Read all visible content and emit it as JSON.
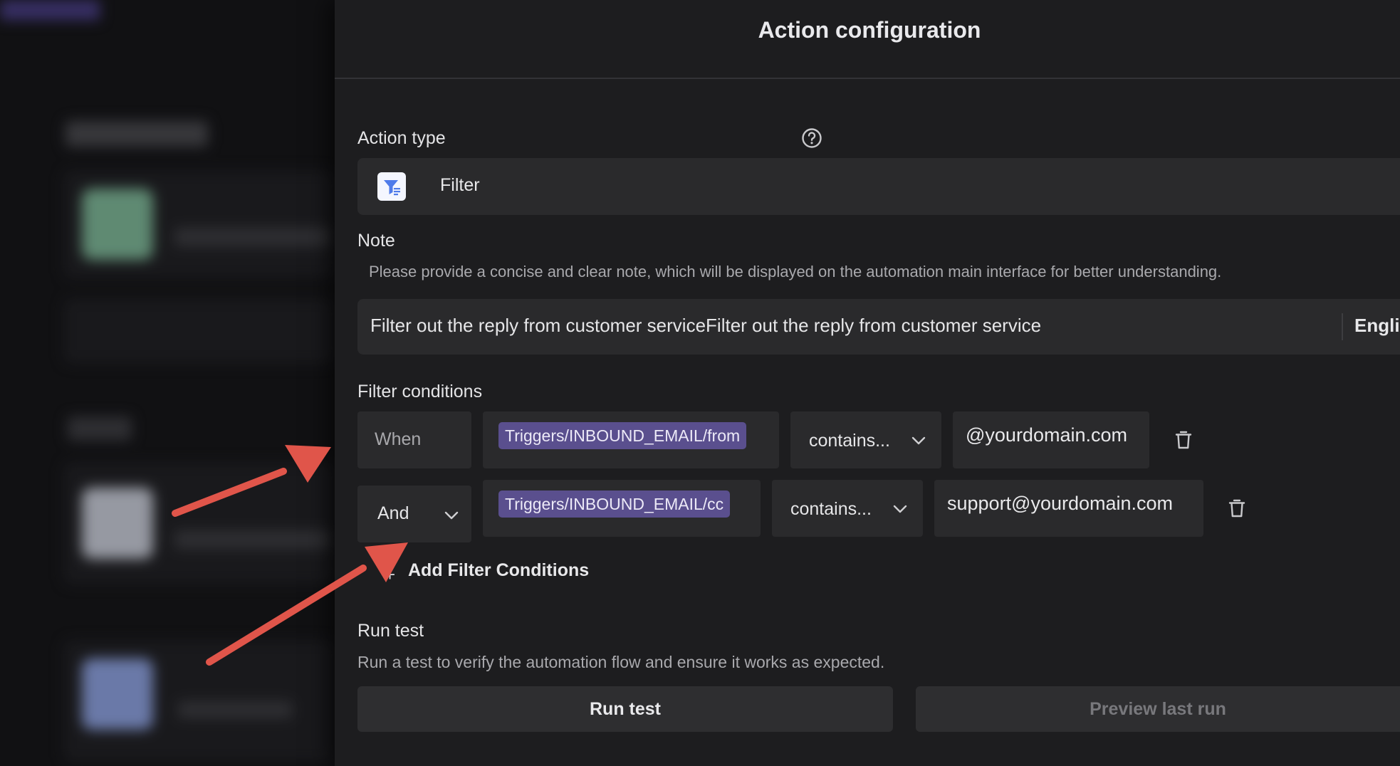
{
  "header": {
    "title": "Action configuration"
  },
  "action_type": {
    "label": "Action type",
    "help_icon": "question-circle-icon",
    "value": "Filter",
    "icon": "filter-icon"
  },
  "note": {
    "label": "Note",
    "description": "Please provide a concise and clear note, which will be displayed on the automation main interface for better understanding.",
    "value": "Filter out the reply from customer serviceFilter out the reply from customer service",
    "language": "English"
  },
  "filter_conditions": {
    "label": "Filter conditions",
    "rows": [
      {
        "connector": "When",
        "variable": "Triggers/INBOUND_EMAIL/from",
        "operator": "contains...",
        "value": "@yourdomain.com"
      },
      {
        "connector": "And",
        "variable": "Triggers/INBOUND_EMAIL/cc",
        "operator": "contains...",
        "value": "support@yourdomain.com"
      }
    ],
    "add_label": "Add Filter Conditions"
  },
  "run_test": {
    "label": "Run test",
    "description": "Run a test to verify the automation flow and ensure it works as expected.",
    "run_button": "Run test",
    "preview_button": "Preview last run"
  },
  "colors": {
    "accent_chip": "#5a4f8e",
    "annotation_arrow": "#e0554a",
    "panel_bg": "#1d1d1f"
  }
}
